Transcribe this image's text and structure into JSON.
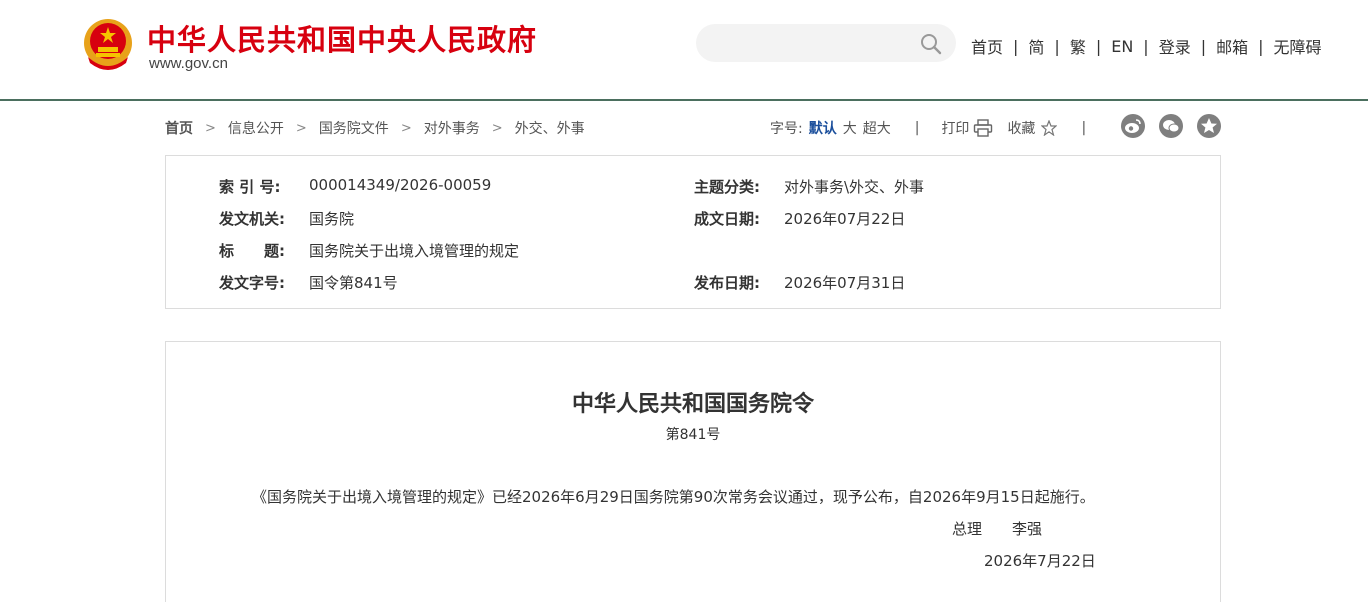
{
  "header": {
    "site_title": "中华人民共和国中央人民政府",
    "site_domain": "www.gov.cn",
    "search_placeholder": "",
    "nav": [
      "首页",
      "简",
      "繁",
      "EN",
      "登录",
      "邮箱",
      "无障碍"
    ]
  },
  "breadcrumb": [
    "首页",
    "信息公开",
    "国务院文件",
    "对外事务",
    "外交、外事"
  ],
  "tools": {
    "font_label": "字号:",
    "font_default": "默认",
    "font_large": "大",
    "font_xlarge": "超大",
    "print": "打印",
    "favorite": "收藏"
  },
  "social_icons": [
    "weibo-icon",
    "wechat-icon",
    "qzone-icon"
  ],
  "meta": {
    "index_label": "索 引 号:",
    "index_value": "000014349/2026-00059",
    "topic_label": "主题分类:",
    "topic_value": "对外事务\\外交、外事",
    "issuer_label": "发文机关:",
    "issuer_value": "国务院",
    "written_date_label": "成文日期:",
    "written_date_value": "2026年07月22日",
    "title_label": "标　　题:",
    "title_value": "国务院关于出境入境管理的规定",
    "doc_no_label": "发文字号:",
    "doc_no_value": "国令第841号",
    "publish_date_label": "发布日期:",
    "publish_date_value": "2026年07月31日"
  },
  "article": {
    "title": "中华人民共和国国务院令",
    "number": "第841号",
    "body": "《国务院关于出境入境管理的规定》已经2026年6月29日国务院第90次常务会议通过，现予公布，自2026年9月15日起施行。",
    "signer_title": "总理",
    "signer_name": "李强",
    "date": "2026年7月22日"
  },
  "colors": {
    "brand_red": "#d7000f",
    "header_line": "#4b6f5e",
    "active_blue": "#1b4f9c"
  }
}
